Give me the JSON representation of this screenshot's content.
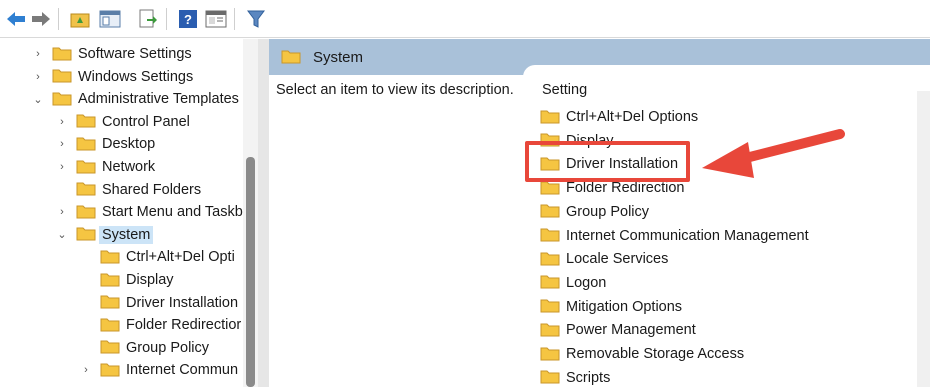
{
  "colors": {
    "accent_arrow": "#e8473a",
    "header_bg": "#a9c1d9",
    "selection_bg": "#cce4f7",
    "folder": "#f5c542"
  },
  "toolbar": {
    "icons": [
      "back-arrow-icon",
      "forward-arrow-icon",
      "up-folder-icon",
      "show-hide-tree-icon",
      "export-list-icon",
      "help-icon",
      "properties-view-icon",
      "filter-icon"
    ]
  },
  "tree": {
    "items": [
      {
        "label": "Software Settings",
        "expander": "›",
        "indent": 0
      },
      {
        "label": "Windows Settings",
        "expander": "›",
        "indent": 0
      },
      {
        "label": "Administrative Templates",
        "expander": "⌄",
        "indent": 0
      },
      {
        "label": "Control Panel",
        "expander": "›",
        "indent": 1
      },
      {
        "label": "Desktop",
        "expander": "›",
        "indent": 1
      },
      {
        "label": "Network",
        "expander": "›",
        "indent": 1
      },
      {
        "label": "Shared Folders",
        "expander": "",
        "indent": 1
      },
      {
        "label": "Start Menu and Taskb",
        "expander": "›",
        "indent": 1
      },
      {
        "label": "System",
        "expander": "⌄",
        "indent": 1,
        "selected": true
      },
      {
        "label": "Ctrl+Alt+Del Opti",
        "expander": "",
        "indent": 2
      },
      {
        "label": "Display",
        "expander": "",
        "indent": 2
      },
      {
        "label": "Driver Installation",
        "expander": "",
        "indent": 2
      },
      {
        "label": "Folder Redirectior",
        "expander": "",
        "indent": 2
      },
      {
        "label": "Group Policy",
        "expander": "",
        "indent": 2
      },
      {
        "label": "Internet Commun",
        "expander": "›",
        "indent": 2
      }
    ]
  },
  "right_pane": {
    "header_title": "System",
    "description": "Select an item to view its description.",
    "column_header": "Setting",
    "items": [
      "Ctrl+Alt+Del Options",
      "Display",
      "Driver Installation",
      "Folder Redirection",
      "Group Policy",
      "Internet Communication Management",
      "Locale Services",
      "Logon",
      "Mitigation Options",
      "Power Management",
      "Removable Storage Access",
      "Scripts"
    ],
    "highlighted_item": "Driver Installation"
  }
}
